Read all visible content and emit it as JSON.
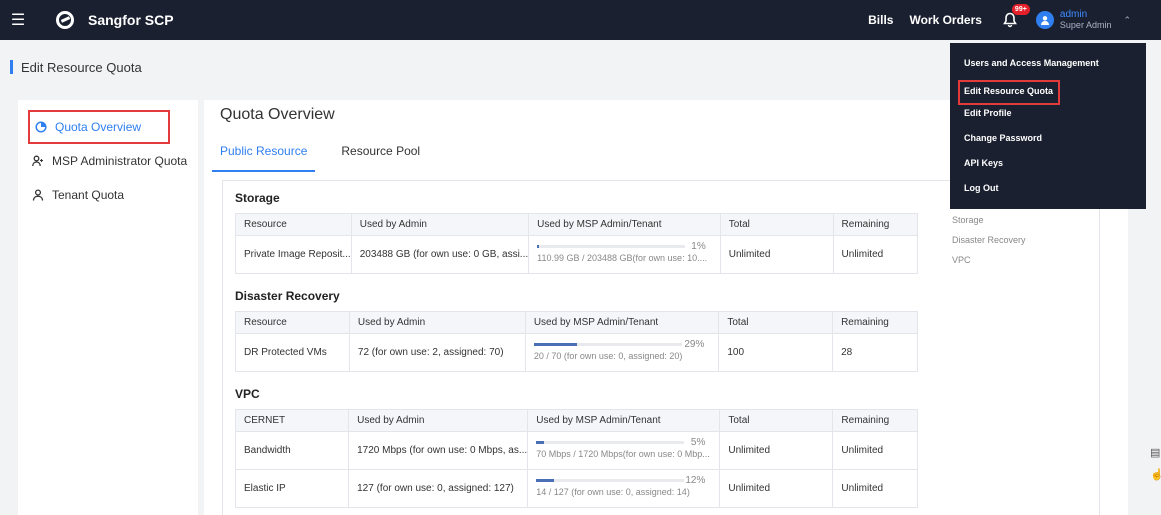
{
  "header": {
    "menu_icon": "hamburger-icon",
    "app_title": "Sangfor SCP",
    "links": [
      "Bills",
      "Work Orders"
    ],
    "notification_badge": "99+",
    "user_name": "admin",
    "user_role": "Super Admin"
  },
  "page": {
    "title": "Edit Resource Quota"
  },
  "sidebar": {
    "items": [
      {
        "label": "Quota Overview",
        "icon": "quota-icon",
        "active": true
      },
      {
        "label": "MSP Administrator Quota",
        "icon": "users-icon",
        "active": false
      },
      {
        "label": "Tenant Quota",
        "icon": "user-icon",
        "active": false
      }
    ]
  },
  "main": {
    "title": "Quota Overview",
    "tabs": [
      {
        "label": "Public Resource",
        "active": true
      },
      {
        "label": "Resource Pool",
        "active": false
      }
    ]
  },
  "sections": {
    "storage": {
      "title": "Storage",
      "headers": [
        "Resource",
        "Used by Admin",
        "Used by MSP Admin/Tenant",
        "Total",
        "Remaining"
      ],
      "rows": [
        {
          "resource": "Private Image Reposit...",
          "admin": "203488 GB (for own use: 0 GB, assi...",
          "pct": "1%",
          "pct_value": 1,
          "msp": "110.99 GB / 203488 GB(for own use: 10....",
          "total": "Unlimited",
          "remaining": "Unlimited"
        }
      ]
    },
    "dr": {
      "title": "Disaster Recovery",
      "headers": [
        "Resource",
        "Used by Admin",
        "Used by MSP Admin/Tenant",
        "Total",
        "Remaining"
      ],
      "rows": [
        {
          "resource": "DR Protected VMs",
          "admin": "72 (for own use: 2, assigned: 70)",
          "pct": "29%",
          "pct_value": 29,
          "msp": "20 / 70 (for own use: 0, assigned: 20)",
          "total": "100",
          "remaining": "28"
        }
      ]
    },
    "vpc": {
      "title": "VPC",
      "headers": [
        "CERNET",
        "Used by Admin",
        "Used by MSP Admin/Tenant",
        "Total",
        "Remaining"
      ],
      "rows": [
        {
          "resource": "Bandwidth",
          "admin": "1720 Mbps (for own use: 0 Mbps, as...",
          "pct": "5%",
          "pct_value": 5,
          "msp": "70 Mbps / 1720 Mbps(for own use: 0 Mbp...",
          "total": "Unlimited",
          "remaining": "Unlimited"
        },
        {
          "resource": "Elastic IP",
          "admin": "127 (for own use: 0, assigned: 127)",
          "pct": "12%",
          "pct_value": 12,
          "msp": "14 / 127 (for own use: 0, assigned: 14)",
          "total": "Unlimited",
          "remaining": "Unlimited"
        }
      ]
    }
  },
  "anchor_nav": [
    "Storage",
    "Disaster Recovery",
    "VPC"
  ],
  "user_menu": {
    "items": [
      "Users and Access Management",
      "Edit Resource Quota",
      "Edit Profile",
      "Change Password",
      "API Keys",
      "Log Out"
    ]
  },
  "colors": {
    "accent": "#2f7ff0",
    "topbar": "#1b2030",
    "highlight": "#e33b3b"
  }
}
